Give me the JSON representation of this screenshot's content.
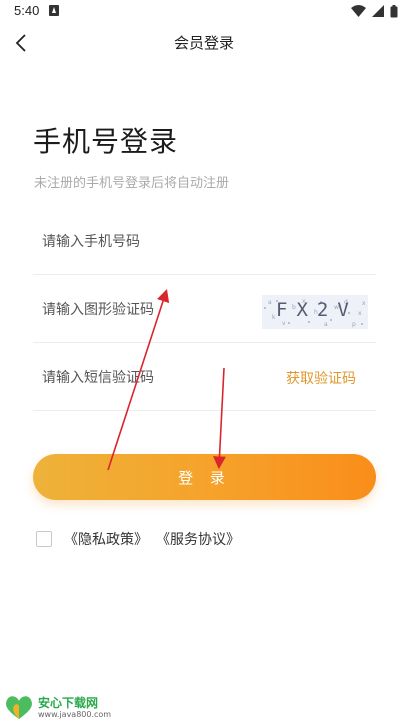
{
  "status_bar": {
    "time": "5:40"
  },
  "header": {
    "title": "会员登录",
    "back_icon": "chevron-left-icon"
  },
  "page": {
    "title": "手机号登录",
    "subtitle": "未注册的手机号登录后将自动注册"
  },
  "form": {
    "phone_placeholder": "请输入手机号码",
    "captcha_placeholder": "请输入图形验证码",
    "captcha_image_text": "FX2V",
    "sms_placeholder": "请输入短信验证码",
    "sms_button_label": "获取验证码",
    "login_button_label": "登 录"
  },
  "agreement": {
    "checked": false,
    "privacy_link": "《隐私政策》",
    "service_link": "《服务协议》"
  },
  "watermark": {
    "name": "安心下载网",
    "url": "www.java800.com"
  },
  "colors": {
    "accent": "#f6a12a",
    "link": "#e0972c",
    "annotation": "#d9262c"
  }
}
